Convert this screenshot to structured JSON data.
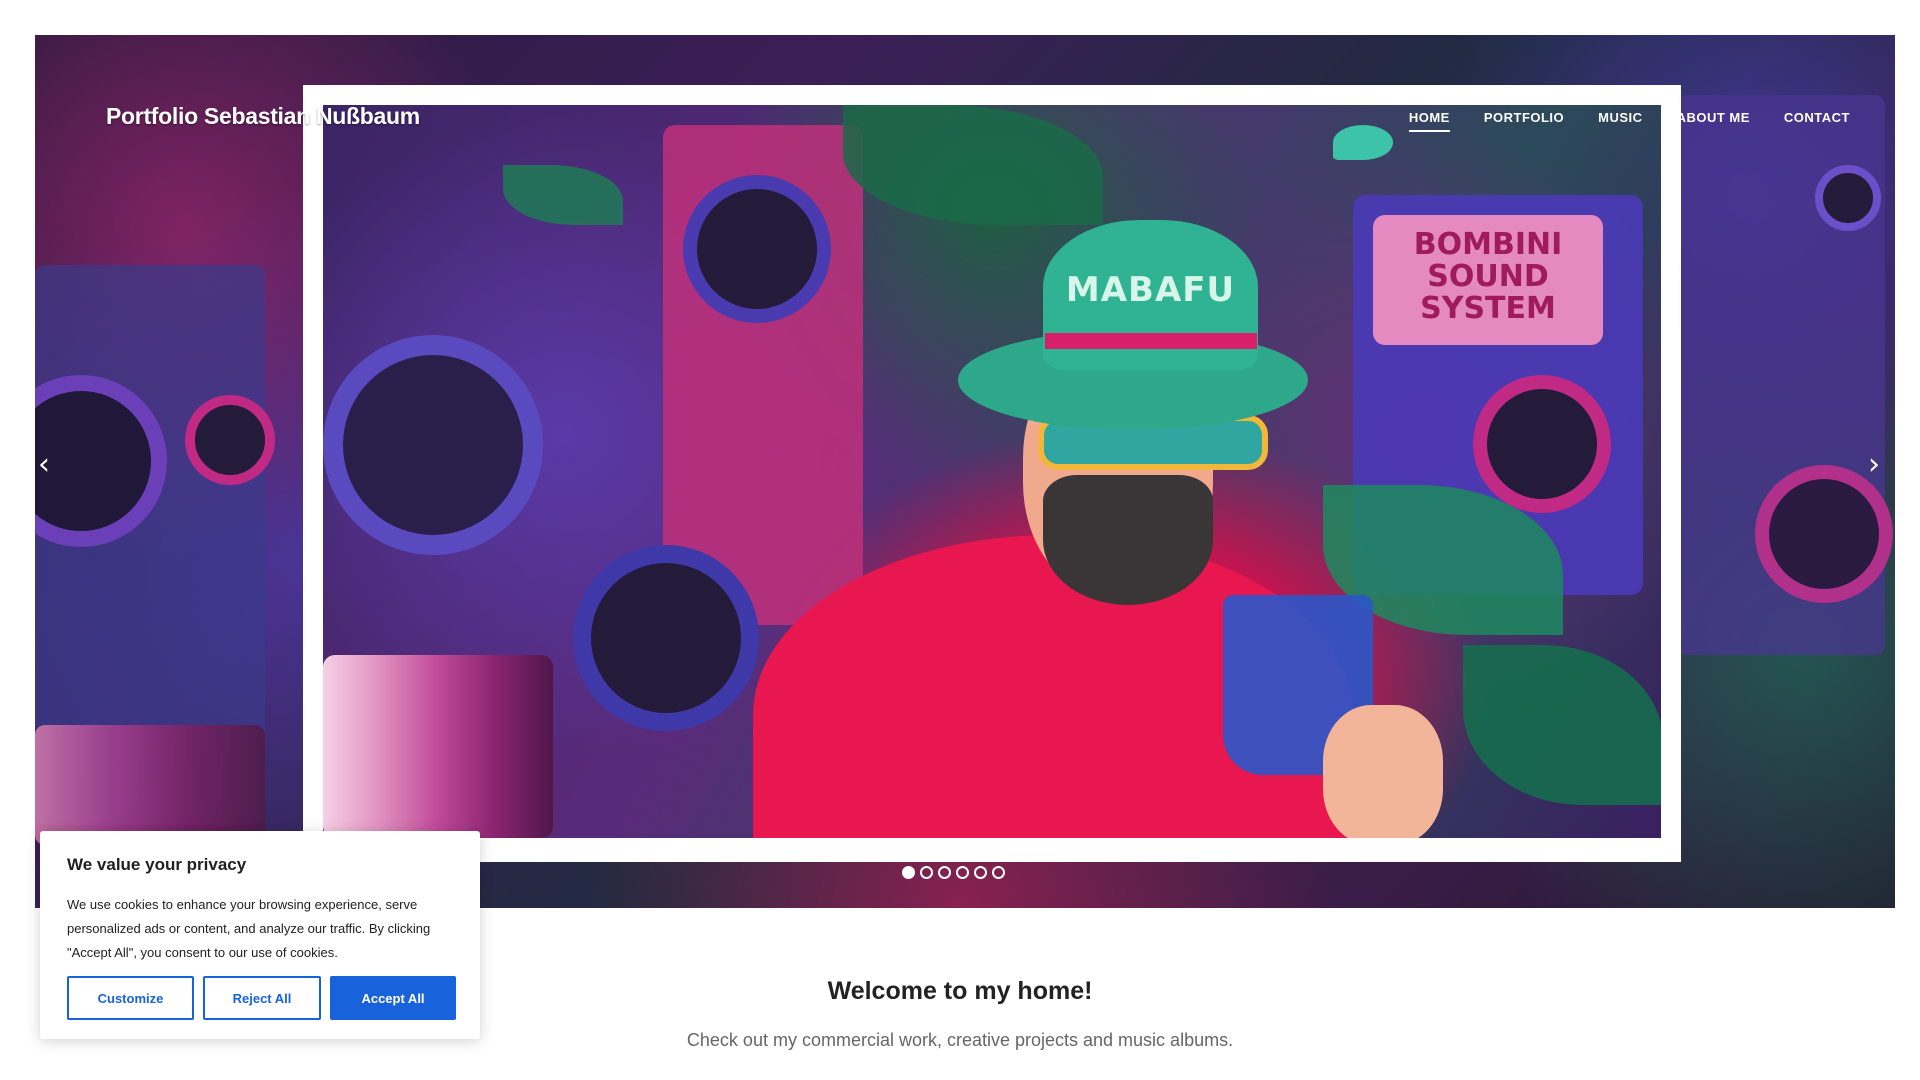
{
  "site": {
    "brand": "Portfolio Sebastian Nußbaum"
  },
  "nav": {
    "items": [
      {
        "label": "HOME",
        "active": true
      },
      {
        "label": "PORTFOLIO",
        "active": false
      },
      {
        "label": "MUSIC",
        "active": false
      },
      {
        "label": "ABOUT ME",
        "active": false
      },
      {
        "label": "CONTACT",
        "active": false
      }
    ]
  },
  "slider": {
    "prev_icon": "chevron-left-icon",
    "next_icon": "chevron-right-icon",
    "slide_count": 6,
    "active_index": 0,
    "artwork_text": {
      "hat": "MABAFU",
      "sign": [
        "BOMBINI",
        "SOUND",
        "SYSTEM"
      ]
    }
  },
  "intro": {
    "heading": "Welcome to my home!",
    "subheading": "Check out my commercial work, creative projects and music albums."
  },
  "cookie_banner": {
    "title": "We value your privacy",
    "text": "We use cookies to enhance your browsing experience, serve personalized ads or content, and analyze our traffic. By clicking \"Accept All\", you consent to our use of cookies.",
    "customize_label": "Customize",
    "reject_label": "Reject All",
    "accept_label": "Accept All",
    "accent_color": "#1863dc"
  }
}
